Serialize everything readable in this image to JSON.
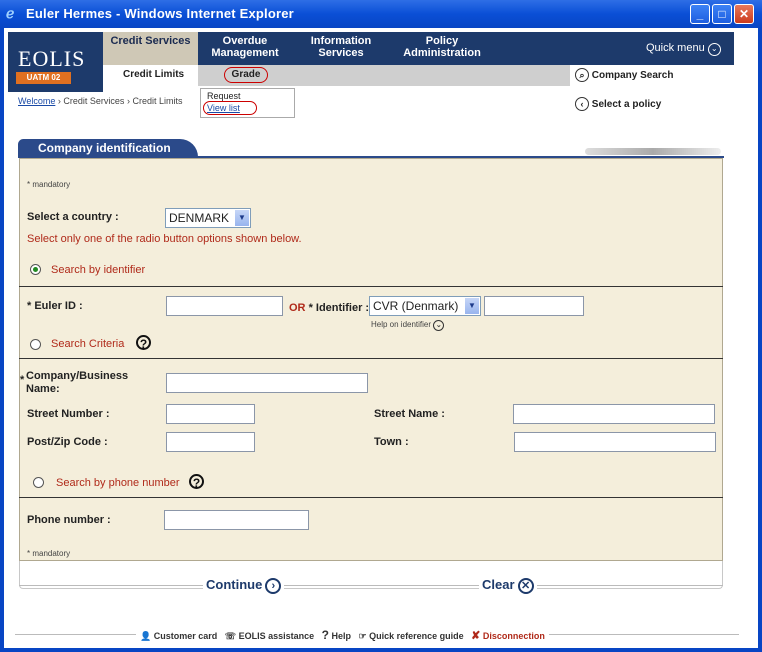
{
  "window": {
    "title": "Euler Hermes - Windows Internet Explorer"
  },
  "logo": {
    "brand": "EOLIS",
    "sub": "UATM 02"
  },
  "nav": {
    "credit_services": "Credit Services",
    "overdue_management": "Overdue Management",
    "information_services": "Information Services",
    "policy_administration": "Policy Administration",
    "quick_menu": "Quick menu"
  },
  "subnav": {
    "credit_limits": "Credit Limits",
    "grade": "Grade"
  },
  "dropdown": {
    "request": "Request",
    "view_list": "View list"
  },
  "right_links": {
    "company_search": "Company Search",
    "select_policy": "Select a policy"
  },
  "breadcrumb": {
    "welcome": "Welcome",
    "credit_services": "Credit Services",
    "credit_limits": "Credit Limits",
    "sep": "›"
  },
  "panel": {
    "tab": "Company identification",
    "mandatory_top": "* mandatory",
    "select_country_label": "Select a country :",
    "country_value": "DENMARK",
    "radio_hint": "Select only one of the radio button options shown below.",
    "search_by_identifier": "Search by identifier",
    "euler_id_label": "* Euler ID :",
    "or": "OR",
    "identifier_label": "* Identifier :",
    "identifier_type": "CVR (Denmark)",
    "help_identifier": "Help on identifier",
    "search_criteria": "Search Criteria",
    "company_name_label": "Company/Business Name:",
    "company_name_star": "*",
    "street_number_label": "Street Number :",
    "street_name_label": "Street Name :",
    "postcode_label": "Post/Zip Code :",
    "town_label": "Town :",
    "search_by_phone": "Search by phone number",
    "phone_label": "Phone number :",
    "mandatory_bottom": "* mandatory"
  },
  "actions": {
    "continue": "Continue",
    "clear": "Clear"
  },
  "footer": {
    "customer_card": "Customer card",
    "eolis_assistance": "EOLIS assistance",
    "help": "Help",
    "quick_ref": "Quick reference guide",
    "disconnection": "Disconnection"
  }
}
